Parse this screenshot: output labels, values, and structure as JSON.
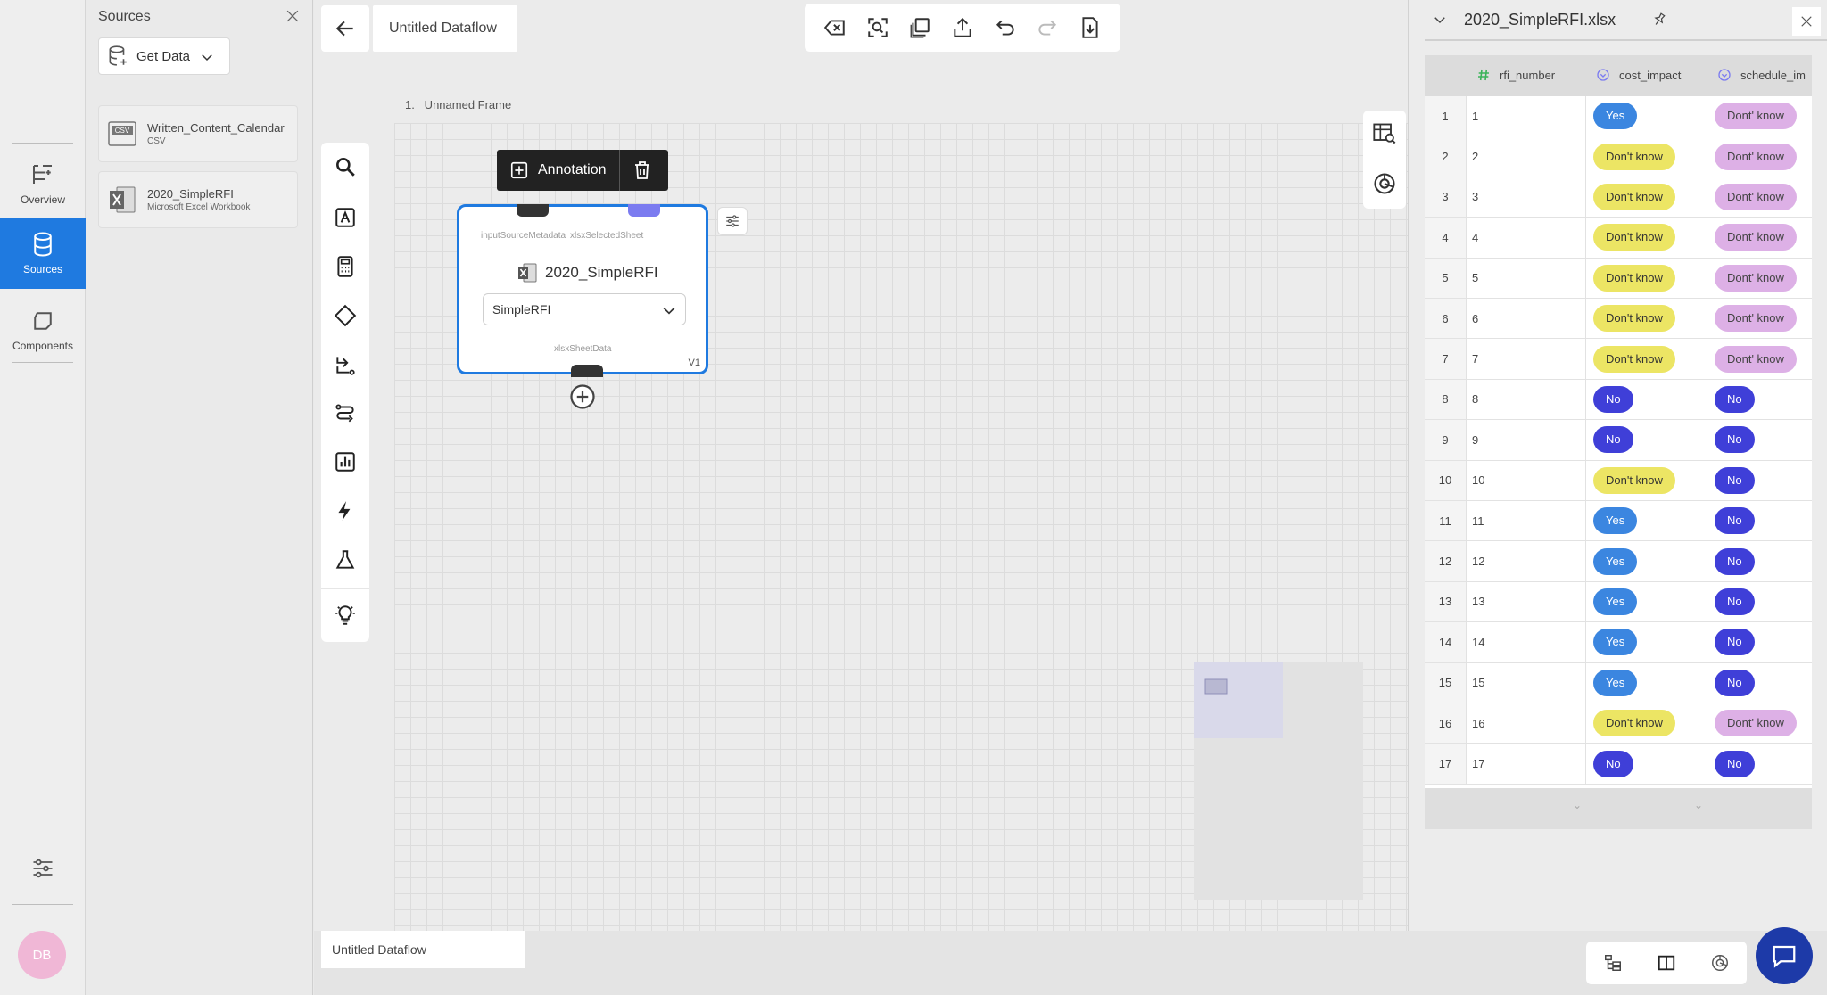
{
  "nav": {
    "items": [
      {
        "label": "Overview",
        "icon": "overview-icon"
      },
      {
        "label": "Sources",
        "icon": "database-icon",
        "active": true
      },
      {
        "label": "Components",
        "icon": "components-icon"
      }
    ],
    "avatar_initials": "DB"
  },
  "sources_panel": {
    "title": "Sources",
    "get_data_label": "Get Data",
    "items": [
      {
        "name": "Written_Content_Calendar",
        "type": "CSV",
        "icon": "csv-file-icon"
      },
      {
        "name": "2020_SimpleRFI",
        "type": "Microsoft Excel Workbook",
        "icon": "excel-file-icon"
      }
    ]
  },
  "canvas": {
    "dataflow_title": "Untitled Dataflow",
    "frame_label": "1.   Unnamed Frame",
    "annotation_label": "Annotation",
    "node": {
      "input_port_label": "inputSourceMetadata",
      "selected_port_label": "xlsxSelectedSheet",
      "name": "2020_SimpleRFI",
      "sheet_value": "SimpleRFI",
      "output_port_label": "xlsxSheetData",
      "version": "V1"
    },
    "bottom_tab": "Untitled Dataflow"
  },
  "table_panel": {
    "file_title": "2020_SimpleRFI.xlsx",
    "columns": [
      "rfi_number",
      "cost_impact",
      "schedule_im"
    ],
    "rows": [
      {
        "idx": "1",
        "rfi_number": "1",
        "cost_impact": "Yes",
        "schedule_impact": "Dont' know"
      },
      {
        "idx": "2",
        "rfi_number": "2",
        "cost_impact": "Don't know",
        "schedule_impact": "Dont' know"
      },
      {
        "idx": "3",
        "rfi_number": "3",
        "cost_impact": "Don't know",
        "schedule_impact": "Dont' know"
      },
      {
        "idx": "4",
        "rfi_number": "4",
        "cost_impact": "Don't know",
        "schedule_impact": "Dont' know"
      },
      {
        "idx": "5",
        "rfi_number": "5",
        "cost_impact": "Don't know",
        "schedule_impact": "Dont' know"
      },
      {
        "idx": "6",
        "rfi_number": "6",
        "cost_impact": "Don't know",
        "schedule_impact": "Dont' know"
      },
      {
        "idx": "7",
        "rfi_number": "7",
        "cost_impact": "Don't know",
        "schedule_impact": "Dont' know"
      },
      {
        "idx": "8",
        "rfi_number": "8",
        "cost_impact": "No",
        "schedule_impact": "No"
      },
      {
        "idx": "9",
        "rfi_number": "9",
        "cost_impact": "No",
        "schedule_impact": "No"
      },
      {
        "idx": "10",
        "rfi_number": "10",
        "cost_impact": "Don't know",
        "schedule_impact": "No"
      },
      {
        "idx": "11",
        "rfi_number": "11",
        "cost_impact": "Yes",
        "schedule_impact": "No"
      },
      {
        "idx": "12",
        "rfi_number": "12",
        "cost_impact": "Yes",
        "schedule_impact": "No"
      },
      {
        "idx": "13",
        "rfi_number": "13",
        "cost_impact": "Yes",
        "schedule_impact": "No"
      },
      {
        "idx": "14",
        "rfi_number": "14",
        "cost_impact": "Yes",
        "schedule_impact": "No"
      },
      {
        "idx": "15",
        "rfi_number": "15",
        "cost_impact": "Yes",
        "schedule_impact": "No"
      },
      {
        "idx": "16",
        "rfi_number": "16",
        "cost_impact": "Don't know",
        "schedule_impact": "Dont' know"
      },
      {
        "idx": "17",
        "rfi_number": "17",
        "cost_impact": "No",
        "schedule_impact": "No"
      }
    ]
  },
  "colors": {
    "accent": "#1f7ae0",
    "pill_yes": "#3b86e0",
    "pill_dont_know": "#ece564",
    "pill_no": "#3f3fd8",
    "pill_dont_know_schedule": "#ddb0e6"
  }
}
